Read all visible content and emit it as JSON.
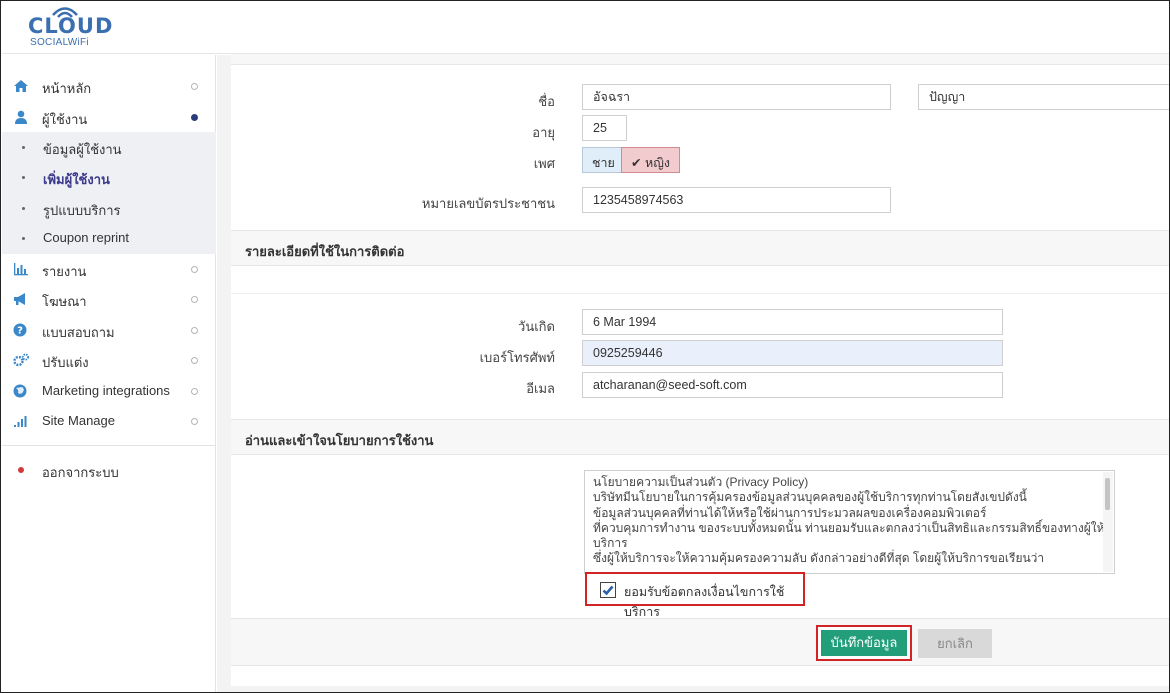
{
  "brand": {
    "title": "CLOUD",
    "subtitle": "SOCIALWiFi"
  },
  "sidebar": {
    "items": [
      {
        "label": "หน้าหลัก",
        "icon": "home-icon"
      },
      {
        "label": "ผู้ใช้งาน",
        "icon": "user-icon",
        "active": true
      },
      {
        "label": "รายงาน",
        "icon": "bar-chart-icon"
      },
      {
        "label": "โฆษณา",
        "icon": "megaphone-icon"
      },
      {
        "label": "แบบสอบถาม",
        "icon": "question-icon"
      },
      {
        "label": "ปรับแต่ง",
        "icon": "cogs-icon"
      },
      {
        "label": "Marketing integrations",
        "icon": "globe-icon"
      },
      {
        "label": "Site Manage",
        "icon": "signal-icon"
      }
    ],
    "subitems": [
      {
        "label": "ข้อมูลผู้ใช้งาน"
      },
      {
        "label": "เพิ่มผู้ใช้งาน",
        "active": true
      },
      {
        "label": "รูปแบบบริการ"
      },
      {
        "label": "Coupon reprint"
      }
    ],
    "logout": "ออกจากระบบ"
  },
  "form": {
    "personal": {
      "name_label": "ชื่อ",
      "first_name": "อัจฉรา",
      "last_name": "ปัญญา",
      "age_label": "อายุ",
      "age": "25",
      "sex_label": "เพศ",
      "sex_male": "ชาย",
      "sex_female": "หญิง",
      "sex_selected": "หญิง",
      "id_label": "หมายเลขบัตรประชาชน",
      "id_number": "1235458974563"
    },
    "contact": {
      "header": "รายละเอียดที่ใช้ในการติดต่อ",
      "birthday_label": "วันเกิด",
      "birthday": "6 Mar 1994",
      "phone_label": "เบอร์โทรศัพท์",
      "phone": "0925259446",
      "email_label": "อีเมล",
      "email": "atcharanan@seed-soft.com"
    },
    "policy": {
      "header": "อ่านและเข้าใจนโยบายการใช้งาน",
      "lines": [
        "นโยบายความเป็นส่วนตัว (Privacy Policy)",
        "บริษัทมีนโยบายในการคุ้มครองข้อมูลส่วนบุคคลของผู้ใช้บริการทุกท่านโดยสังเขปดังนี้",
        "ข้อมูลส่วนบุคคลที่ท่านได้ให้หรือใช้ผ่านการประมวลผลของเครื่องคอมพิวเตอร์",
        "ที่ควบคุมการทำงาน ของระบบทั้งหมดนั้น ท่านยอมรับและตกลงว่าเป็นสิทธิและกรรมสิทธิ์ของทางผู้ให้",
        "บริการ",
        "ซึ่งผู้ให้บริการจะให้ความคุ้มครองความลับ ดังกล่าวอย่างดีที่สุด โดยผู้ให้บริการขอเรียนว่า"
      ],
      "accept_label": "ยอมรับข้อตกลงเงื่อนไขการใช้บริการ",
      "accepted": true
    },
    "save_label": "บันทึกข้อมูล",
    "cancel_label": "ยกเลิก"
  },
  "colors": {
    "brand": "#3a6fb0",
    "save": "#239e7a",
    "highlight": "#d12525",
    "active_nav": "#3c3a8c"
  }
}
